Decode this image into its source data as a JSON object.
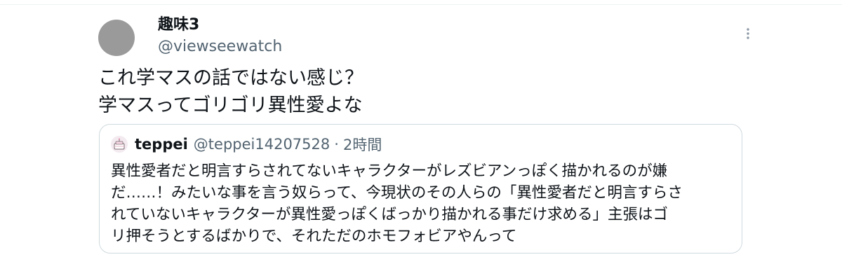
{
  "tweet": {
    "display_name": "趣味3",
    "handle": "@viewseewatch",
    "text_lines": [
      "これ学マスの話ではない感じ？",
      "学マスってゴリゴリ異性愛よな"
    ]
  },
  "quoted_tweet": {
    "display_name": "teppei",
    "handle": "@teppei14207528",
    "separator": "·",
    "time": "2時間",
    "text_lines": [
      "異性愛者だと明言すらされてないキャラクターがレズビアンっぽく描かれるのが嫌",
      "だ……！みたいな事を言う奴らって、今現状のその人らの「異性愛者だと明言すらさ",
      "れていないキャラクターが異性愛っぽくばっかり描かれる事だけ求める」主張はゴ",
      "リ押そうとするばかりで、それただのホモフォビアやんって"
    ]
  },
  "icons": {
    "more": "more-vertical-icon",
    "quote_avatar": "cake-avatar-icon"
  },
  "colors": {
    "secondary_text": "#536471",
    "border": "#cfd9de",
    "avatar_placeholder": "#9a9a9a"
  }
}
